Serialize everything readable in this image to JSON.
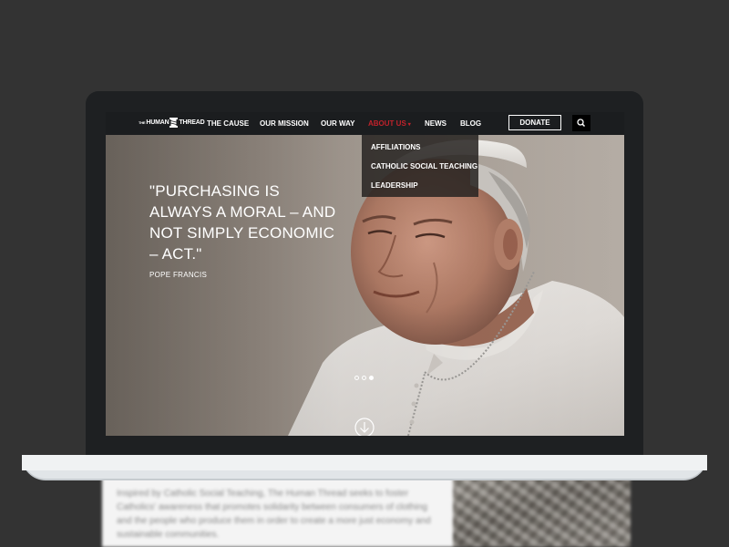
{
  "site": {
    "logo": {
      "the": "THE",
      "human": "HUMAN",
      "thread": "THREAD"
    }
  },
  "nav": {
    "items": [
      {
        "label": "THE CAUSE"
      },
      {
        "label": "OUR MISSION"
      },
      {
        "label": "OUR WAY"
      },
      {
        "label": "ABOUT US"
      },
      {
        "label": "NEWS"
      },
      {
        "label": "BLOG"
      }
    ],
    "donate_label": "DONATE",
    "search_icon": "search-icon",
    "caret_icon": "▾"
  },
  "dropdown": {
    "items": [
      {
        "label": "AFFILIATIONS"
      },
      {
        "label": "CATHOLIC SOCIAL TEACHING"
      },
      {
        "label": "LEADERSHIP"
      }
    ]
  },
  "hero": {
    "quote": "\"PURCHASING IS ALWAYS A MORAL – AND NOT SIMPLY ECONOMIC – ACT.\"",
    "attribution": "POPE FRANCIS",
    "slides_total": 3,
    "active_slide": 3,
    "scroll_icon": "arrow-down-circle-icon"
  },
  "below": {
    "intro": "Inspired by Catholic Social Teaching, The Human Thread seeks to foster Catholics' awareness that promotes solidarity between consumers of clothing and the people who produce them in order to create a more just economy and sustainable communities."
  },
  "colors": {
    "background": "#333333",
    "nav_active": "#c0222b",
    "navbar": "#1b1d1f",
    "dropdown": "#2a2624"
  }
}
